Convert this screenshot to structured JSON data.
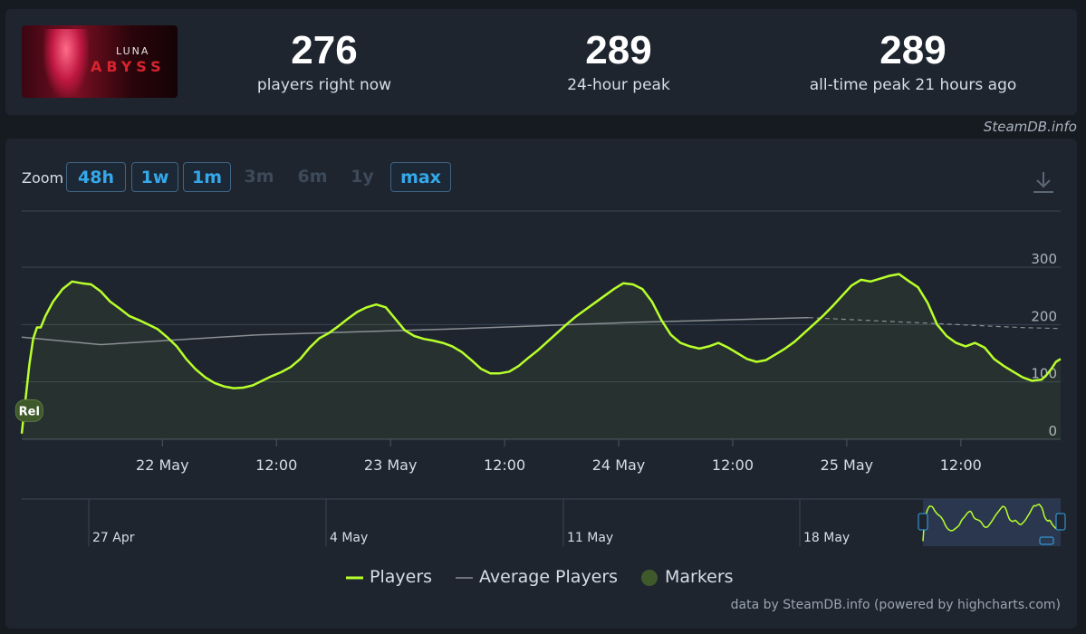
{
  "game": {
    "cover_title_top": "LUNA",
    "cover_title_bottom": "ABYSS"
  },
  "stats": [
    {
      "value": "276",
      "label": "players right now"
    },
    {
      "value": "289",
      "label": "24-hour peak"
    },
    {
      "value": "289",
      "label": "all-time peak 21 hours ago"
    }
  ],
  "brand": "SteamDB.info",
  "zoom": {
    "label": "Zoom",
    "buttons": [
      {
        "label": "48h",
        "enabled": true
      },
      {
        "label": "1w",
        "enabled": true
      },
      {
        "label": "1m",
        "enabled": true
      },
      {
        "label": "3m",
        "enabled": false
      },
      {
        "label": "6m",
        "enabled": false
      },
      {
        "label": "1y",
        "enabled": false
      },
      {
        "label": "max",
        "enabled": true
      }
    ]
  },
  "icons": {
    "download": "download-icon"
  },
  "credits": "data by SteamDB.info (powered by highcharts.com)",
  "colors": {
    "players": "#b8ff2b",
    "average": "#8a8f94",
    "marker": "#3f5a2a",
    "accent": "#35a8ea"
  },
  "chart_data": {
    "type": "line",
    "x_unit": "hours since 21 May 00:00",
    "xlim": [
      -14.8,
      94.5
    ],
    "ylim": [
      0,
      300
    ],
    "y_ticks": [
      0,
      100,
      200,
      300
    ],
    "x_ticks": [
      {
        "x": 0,
        "label": "22 May"
      },
      {
        "x": 12,
        "label": "12:00"
      },
      {
        "x": 24,
        "label": "23 May"
      },
      {
        "x": 36,
        "label": "12:00"
      },
      {
        "x": 48,
        "label": "24 May"
      },
      {
        "x": 60,
        "label": "12:00"
      },
      {
        "x": 72,
        "label": "25 May"
      },
      {
        "x": 84,
        "label": "12:00"
      }
    ],
    "series": [
      {
        "name": "Players",
        "points": [
          [
            -14.8,
            10
          ],
          [
            -14.4,
            70
          ],
          [
            -14.0,
            130
          ],
          [
            -13.6,
            175
          ],
          [
            -13.2,
            195
          ],
          [
            -12.8,
            195
          ],
          [
            -12.3,
            215
          ],
          [
            -11.5,
            240
          ],
          [
            -10.5,
            262
          ],
          [
            -9.5,
            275
          ],
          [
            -8.5,
            272
          ],
          [
            -7.5,
            270
          ],
          [
            -6.5,
            258
          ],
          [
            -5.5,
            240
          ],
          [
            -4.5,
            228
          ],
          [
            -3.5,
            215
          ],
          [
            -2.5,
            208
          ],
          [
            -1.5,
            200
          ],
          [
            -0.5,
            192
          ],
          [
            0.5,
            178
          ],
          [
            1.5,
            162
          ],
          [
            2.5,
            140
          ],
          [
            3.5,
            122
          ],
          [
            4.5,
            108
          ],
          [
            5.5,
            98
          ],
          [
            6.5,
            92
          ],
          [
            7.5,
            89
          ],
          [
            8.5,
            90
          ],
          [
            9.5,
            94
          ],
          [
            10.5,
            102
          ],
          [
            11.5,
            110
          ],
          [
            12.5,
            117
          ],
          [
            13.5,
            126
          ],
          [
            14.5,
            140
          ],
          [
            15.5,
            160
          ],
          [
            16.5,
            176
          ],
          [
            17.5,
            185
          ],
          [
            18.5,
            197
          ],
          [
            19.5,
            210
          ],
          [
            20.5,
            222
          ],
          [
            21.5,
            230
          ],
          [
            22.5,
            235
          ],
          [
            23.5,
            230
          ],
          [
            24.5,
            210
          ],
          [
            25.5,
            190
          ],
          [
            26.5,
            180
          ],
          [
            27.5,
            175
          ],
          [
            28.5,
            172
          ],
          [
            29.5,
            168
          ],
          [
            30.5,
            162
          ],
          [
            31.5,
            152
          ],
          [
            32.5,
            138
          ],
          [
            33.5,
            123
          ],
          [
            34.5,
            115
          ],
          [
            35.5,
            115
          ],
          [
            36.5,
            118
          ],
          [
            37.5,
            128
          ],
          [
            38.5,
            142
          ],
          [
            39.5,
            155
          ],
          [
            40.5,
            170
          ],
          [
            41.5,
            185
          ],
          [
            42.5,
            200
          ],
          [
            43.5,
            214
          ],
          [
            44.5,
            226
          ],
          [
            45.5,
            238
          ],
          [
            46.5,
            250
          ],
          [
            47.5,
            262
          ],
          [
            48.5,
            272
          ],
          [
            49.5,
            270
          ],
          [
            50.5,
            262
          ],
          [
            51.5,
            240
          ],
          [
            52.5,
            208
          ],
          [
            53.5,
            182
          ],
          [
            54.5,
            168
          ],
          [
            55.5,
            162
          ],
          [
            56.5,
            158
          ],
          [
            57.5,
            162
          ],
          [
            58.5,
            168
          ],
          [
            59.5,
            160
          ],
          [
            60.5,
            150
          ],
          [
            61.5,
            140
          ],
          [
            62.5,
            135
          ],
          [
            63.5,
            138
          ],
          [
            64.5,
            148
          ],
          [
            65.5,
            158
          ],
          [
            66.5,
            170
          ],
          [
            67.5,
            185
          ],
          [
            68.5,
            200
          ],
          [
            69.5,
            215
          ],
          [
            70.5,
            232
          ],
          [
            71.5,
            250
          ],
          [
            72.5,
            268
          ],
          [
            73.5,
            278
          ],
          [
            74.5,
            275
          ],
          [
            75.5,
            280
          ],
          [
            76.5,
            285
          ],
          [
            77.5,
            288
          ],
          [
            78.5,
            276
          ],
          [
            79.5,
            265
          ],
          [
            80.5,
            238
          ],
          [
            81.5,
            200
          ],
          [
            82.5,
            180
          ],
          [
            83.5,
            168
          ],
          [
            84.5,
            162
          ],
          [
            85.5,
            168
          ],
          [
            86.5,
            160
          ],
          [
            87.5,
            140
          ],
          [
            88.5,
            128
          ],
          [
            89.5,
            118
          ],
          [
            90.5,
            108
          ],
          [
            91.5,
            102
          ],
          [
            92.5,
            104
          ],
          [
            93.0,
            112
          ],
          [
            93.5,
            122
          ],
          [
            94.0,
            135
          ],
          [
            94.5,
            140
          ]
        ]
      },
      {
        "name": "Average Players",
        "points": [
          [
            -14.8,
            178
          ],
          [
            -6.5,
            165
          ],
          [
            10,
            182
          ],
          [
            30,
            192
          ],
          [
            50,
            204
          ],
          [
            68,
            212
          ],
          [
            90,
            195
          ],
          [
            94.5,
            193
          ]
        ]
      }
    ],
    "navigator": {
      "x_ticks": [
        "27 Apr",
        "4 May",
        "11 May",
        "18 May"
      ]
    },
    "markers": [
      {
        "x": -14.2,
        "y": 50,
        "label": "Rel"
      }
    ],
    "legend": {
      "placement": "bottom-center",
      "items": [
        {
          "label": "Players"
        },
        {
          "label": "Average Players"
        },
        {
          "label": "Markers"
        }
      ]
    }
  }
}
